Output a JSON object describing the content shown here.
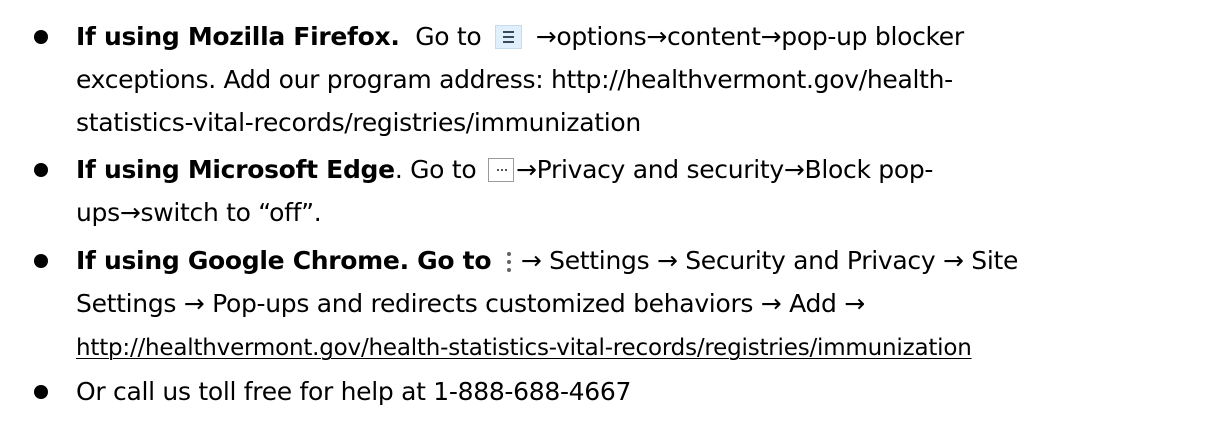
{
  "items": [
    {
      "label": "If using Mozilla Firefox.",
      "lines": [
        {
          "go_to": "Go to",
          "steps": "→options→content→pop-up blocker"
        },
        {
          "text": "exceptions. Add our program address: http://healthvermont.gov/health-"
        },
        {
          "text": "statistics-vital-records/registries/immunization"
        }
      ],
      "icon": "hamburger-menu-icon"
    },
    {
      "label": "If using Microsoft Edge",
      "after_label": ". Go to",
      "lines": [
        {
          "steps": "→Privacy and security→Block pop-"
        },
        {
          "text": "ups→switch to “off”."
        }
      ],
      "icon": "ellipsis-menu-icon"
    },
    {
      "label": "If using Google Chrome. Go to",
      "lines": [
        {
          "steps": "→ Settings → Security and Privacy → Site"
        },
        {
          "text": "Settings → Pop-ups and redirects customized behaviors → Add →"
        },
        {
          "link": "http://healthvermont.gov/health-statistics-vital-records/registries/immunization"
        }
      ],
      "icon": "kebab-menu-icon"
    },
    {
      "text": "Or call us toll free for help at 1-888-688-4667"
    }
  ]
}
